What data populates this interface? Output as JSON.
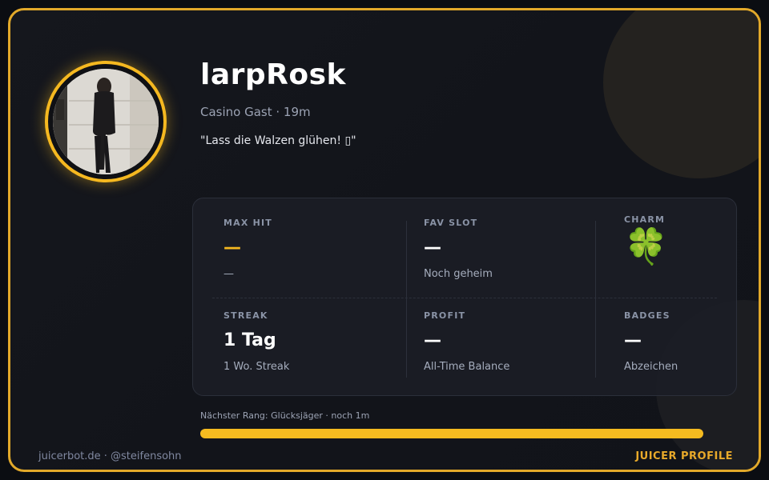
{
  "profile": {
    "name": "larpRosk",
    "subtitle": "Casino Gast · 19m",
    "quote": "\"Lass die Walzen glühen! ▯\""
  },
  "stats": {
    "max_hit": {
      "label": "MAX HIT",
      "value": "—",
      "sub": "—"
    },
    "fav_slot": {
      "label": "FAV SLOT",
      "value": "—",
      "sub": "Noch geheim"
    },
    "charm": {
      "label": "CHARM",
      "icon": "four-leaf-clover-icon",
      "glyph": "🍀"
    },
    "streak": {
      "label": "STREAK",
      "value": "1 Tag",
      "sub": "1 Wo. Streak"
    },
    "profit": {
      "label": "PROFIT",
      "value": "—",
      "sub": "All-Time Balance"
    },
    "badges": {
      "label": "BADGES",
      "value": "—",
      "sub": "Abzeichen"
    }
  },
  "progress": {
    "label": "Nächster Rang: Glücksjäger · noch 1m",
    "fraction": 1.0
  },
  "footer": {
    "left": "juicerbot.de · @steifensohn",
    "right": "JUICER PROFILE"
  },
  "colors": {
    "accent": "#f5b820",
    "frame": "#e2a92a",
    "background": "#12141a"
  }
}
